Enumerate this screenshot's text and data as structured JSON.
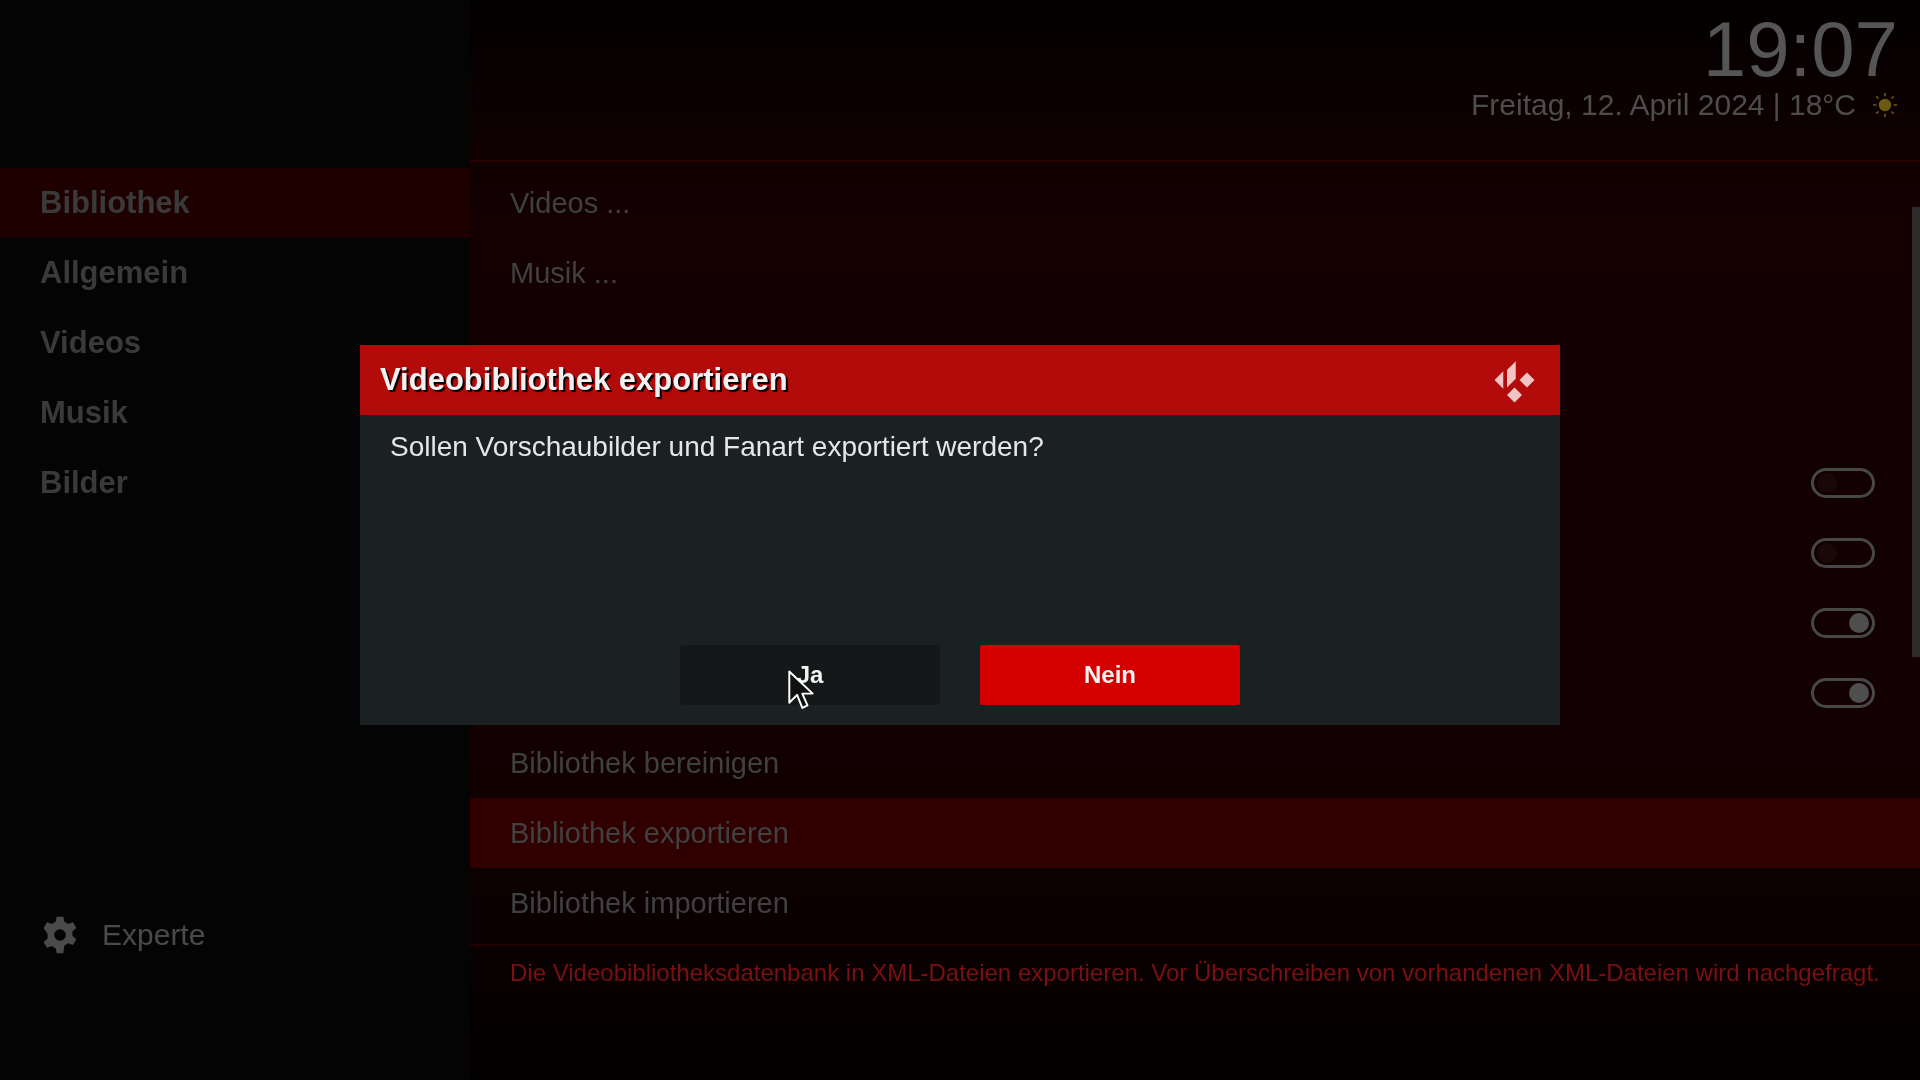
{
  "header": {
    "time": "19:07",
    "date": "Freitag, 12. April 2024 | 18°C"
  },
  "sidebar": {
    "items": [
      {
        "label": "Bibliothek",
        "selected": true
      },
      {
        "label": "Allgemein",
        "selected": false
      },
      {
        "label": "Videos",
        "selected": false
      },
      {
        "label": "Musik",
        "selected": false
      },
      {
        "label": "Bilder",
        "selected": false
      }
    ],
    "level_button": {
      "label": "Experte"
    }
  },
  "settings": {
    "links": [
      {
        "label": "Videos ...",
        "selected": false
      },
      {
        "label": "Musik ...",
        "selected": false
      }
    ],
    "toggles": [
      {
        "on": false
      },
      {
        "on": false
      },
      {
        "on": true
      },
      {
        "on": true
      }
    ],
    "actions": [
      {
        "label": "Bibliothek bereinigen",
        "selected": false
      },
      {
        "label": "Bibliothek exportieren",
        "selected": true
      },
      {
        "label": "Bibliothek importieren",
        "selected": false
      }
    ],
    "description": "Die Videobibliotheksdatenbank in XML-Dateien exportieren. Vor Überschreiben von vorhandenen XML-Dateien wird nachgefragt."
  },
  "dialog": {
    "title": "Videobibliothek exportieren",
    "message": "Sollen Vorschaubilder und Fanart exportiert werden?",
    "buttons": [
      {
        "label": "Ja",
        "selected": false
      },
      {
        "label": "Nein",
        "selected": true
      }
    ]
  }
}
